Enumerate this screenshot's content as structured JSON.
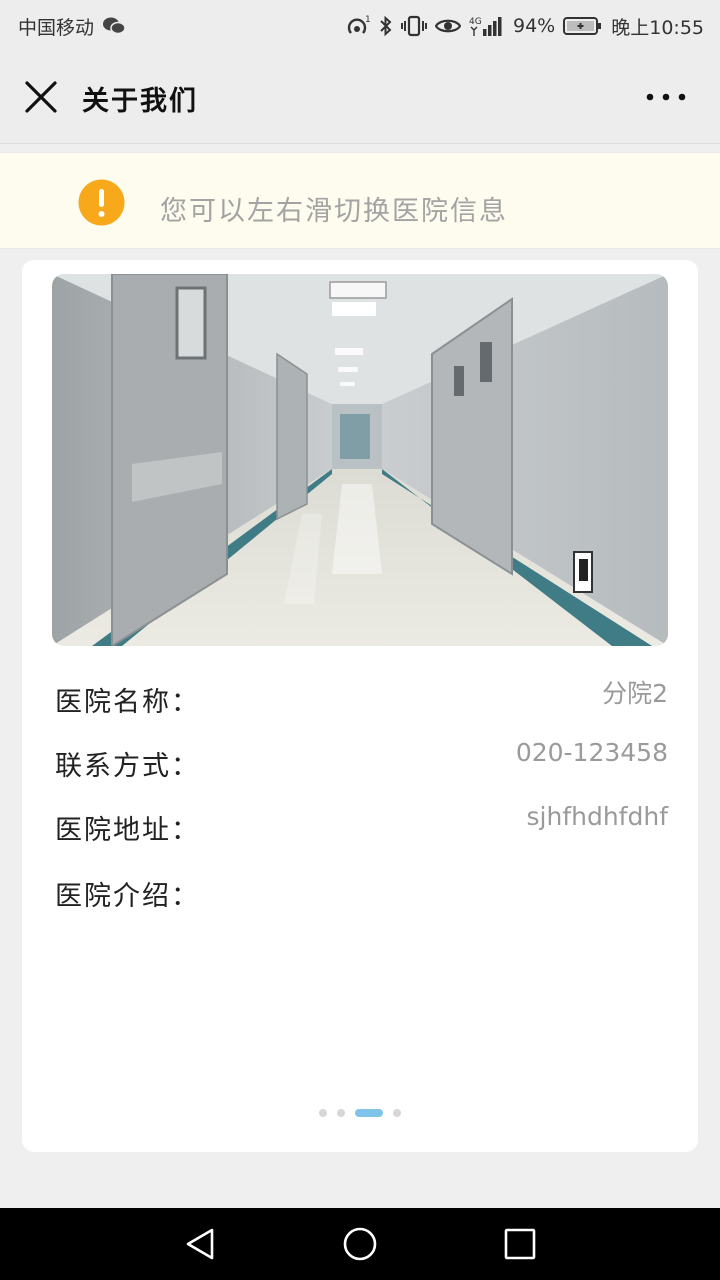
{
  "status_bar": {
    "carrier": "中国移动",
    "battery_pct": "94%",
    "time": "晚上10:55",
    "network": "4G",
    "icons": [
      "wechat-icon",
      "hotspot-icon",
      "bluetooth-icon",
      "vibrate-icon",
      "eye-icon",
      "signal-icon",
      "battery-icon"
    ]
  },
  "nav": {
    "title": "关于我们",
    "close_icon": "close-icon",
    "more_icon": "more-icon"
  },
  "notice": {
    "text": "您可以左右滑切换医院信息",
    "icon": "warning-icon",
    "icon_color": "#f7a81b"
  },
  "hospital": {
    "name_label": "医院名称：",
    "name_value": "分院2",
    "contact_label": "联系方式：",
    "contact_value": "020-123458",
    "address_label": "医院地址：",
    "address_value": "sjhfhdhfdhf",
    "intro_label": "医院介绍：",
    "intro_value": ""
  },
  "carousel": {
    "total_pages": 4,
    "active_page": 3,
    "active_color": "#7fc3ea"
  },
  "system_nav": {
    "icons": [
      "back-icon",
      "home-icon",
      "recents-icon"
    ]
  }
}
